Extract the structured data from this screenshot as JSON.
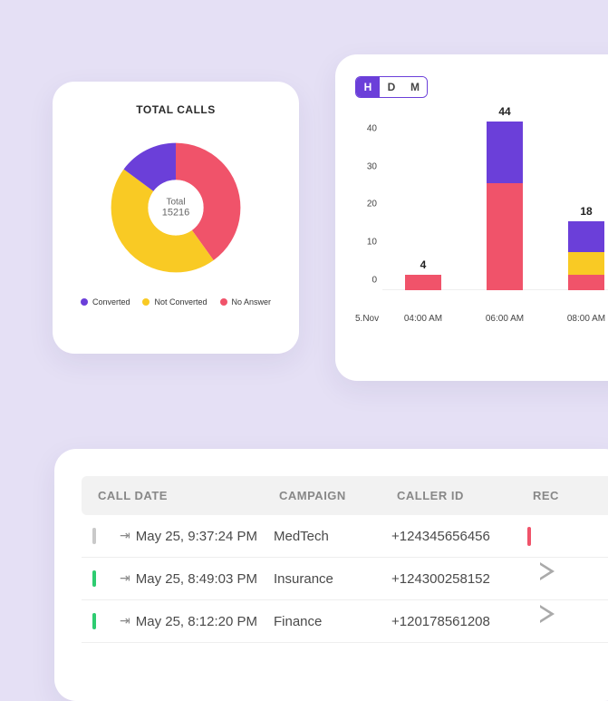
{
  "colors": {
    "purple": "#6B3FD9",
    "red": "#F0536A",
    "yellow": "#F9CA24",
    "green": "#2ECC71",
    "gray": "#C9C9C9"
  },
  "donut": {
    "title": "TOTAL CALLS",
    "center_label": "Total",
    "center_value": "15216",
    "legend": [
      {
        "label": "Converted",
        "color": "#6B3FD9"
      },
      {
        "label": "Not Converted",
        "color": "#F9CA24"
      },
      {
        "label": "No Answer",
        "color": "#F0536A"
      }
    ]
  },
  "bar": {
    "toggle": {
      "options": [
        "H",
        "D",
        "M"
      ],
      "active": "H"
    },
    "x_corner": "5.Nov"
  },
  "chart_data": [
    {
      "type": "pie",
      "title": "TOTAL CALLS",
      "total": 15216,
      "series": [
        {
          "name": "Converted",
          "value": 2282,
          "color": "#6B3FD9"
        },
        {
          "name": "Not Converted",
          "value": 6847,
          "color": "#F9CA24"
        },
        {
          "name": "No Answer",
          "value": 6087,
          "color": "#F0536A"
        }
      ]
    },
    {
      "type": "bar",
      "stacked": true,
      "ylim": [
        0,
        45
      ],
      "yticks": [
        0,
        10,
        20,
        30,
        40
      ],
      "categories": [
        "04:00 AM",
        "06:00 AM",
        "08:00 AM"
      ],
      "series": [
        {
          "name": "No Answer",
          "color": "#F0536A",
          "values": [
            4,
            28,
            4
          ]
        },
        {
          "name": "Not Converted",
          "color": "#F9CA24",
          "values": [
            0,
            0,
            6
          ]
        },
        {
          "name": "Converted",
          "color": "#6B3FD9",
          "values": [
            0,
            16,
            8
          ]
        }
      ],
      "totals": [
        4,
        44,
        18
      ]
    }
  ],
  "table": {
    "headers": {
      "date": "CALL DATE",
      "campaign": "CAMPAIGN",
      "caller": "CALLER ID",
      "rec": "REC"
    },
    "rows": [
      {
        "status_color": "#C9C9C9",
        "date": "May 25, 9:37:24 PM",
        "campaign": "MedTech",
        "caller": "+124345656456",
        "rec": "stop"
      },
      {
        "status_color": "#2ECC71",
        "date": "May 25, 8:49:03 PM",
        "campaign": "Insurance",
        "caller": "+124300258152",
        "rec": "play"
      },
      {
        "status_color": "#2ECC71",
        "date": "May 25, 8:12:20 PM",
        "campaign": "Finance",
        "caller": "+120178561208",
        "rec": "play"
      }
    ]
  }
}
